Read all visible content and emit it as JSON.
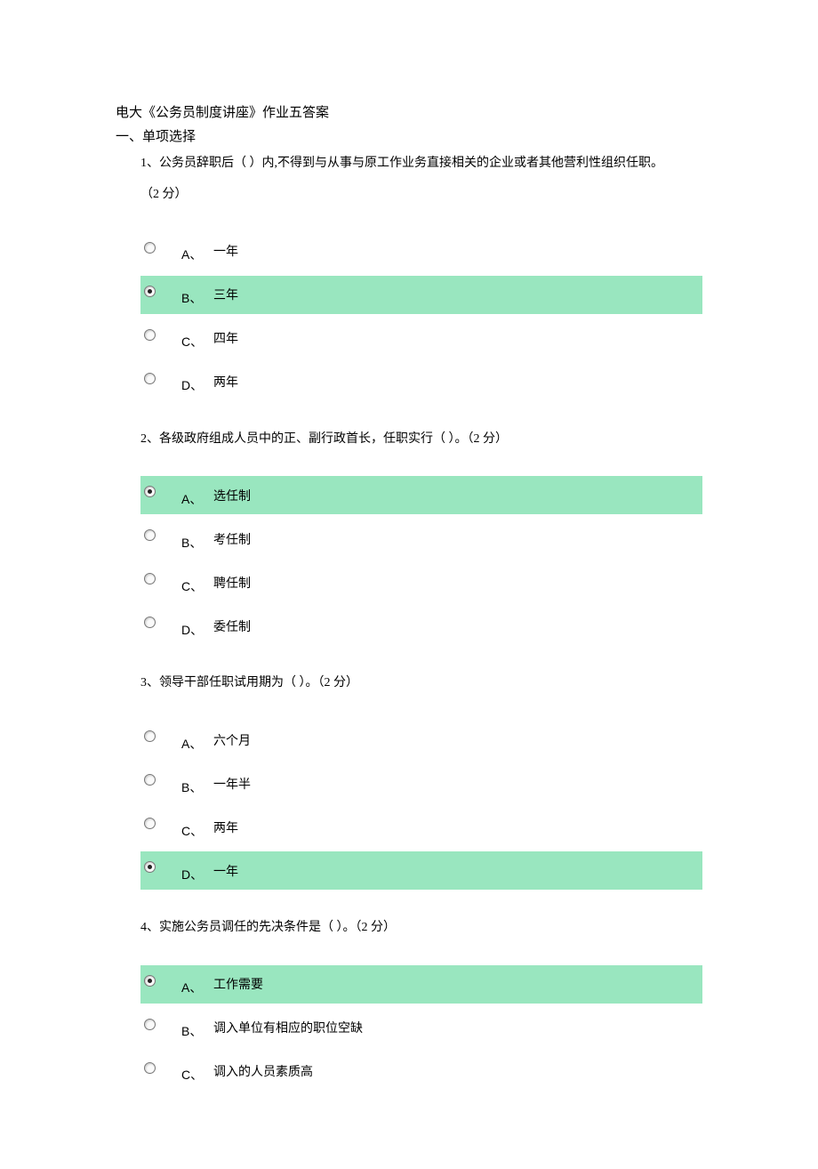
{
  "doc_title": "电大《公务员制度讲座》作业五答案",
  "section_title": "一、单项选择",
  "questions": [
    {
      "number": "1、",
      "text": "公务员辞职后（ ）内,不得到与从事与原工作业务直接相关的企业或者其他营利性组织任职。",
      "points_line": "（2 分）",
      "selected": 1,
      "options": [
        {
          "letter": "A、",
          "text": "一年"
        },
        {
          "letter": "B、",
          "text": "三年"
        },
        {
          "letter": "C、",
          "text": "四年"
        },
        {
          "letter": "D、",
          "text": "两年"
        }
      ]
    },
    {
      "number": "2、",
      "text": "各级政府组成人员中的正、副行政首长，任职实行（ ）。（2 分）",
      "selected": 0,
      "options": [
        {
          "letter": "A、",
          "text": "选任制"
        },
        {
          "letter": "B、",
          "text": "考任制"
        },
        {
          "letter": "C、",
          "text": "聘任制"
        },
        {
          "letter": "D、",
          "text": "委任制"
        }
      ]
    },
    {
      "number": "3、",
      "text": "领导干部任职试用期为（ ）。（2 分）",
      "selected": 3,
      "options": [
        {
          "letter": "A、",
          "text": "六个月"
        },
        {
          "letter": "B、",
          "text": "一年半"
        },
        {
          "letter": "C、",
          "text": "两年"
        },
        {
          "letter": "D、",
          "text": "一年"
        }
      ]
    },
    {
      "number": "4、",
      "text": "实施公务员调任的先决条件是（ ）。（2 分）",
      "selected": 0,
      "options": [
        {
          "letter": "A、",
          "text": "工作需要"
        },
        {
          "letter": "B、",
          "text": "调入单位有相应的职位空缺"
        },
        {
          "letter": "C、",
          "text": "调入的人员素质高"
        }
      ]
    }
  ]
}
